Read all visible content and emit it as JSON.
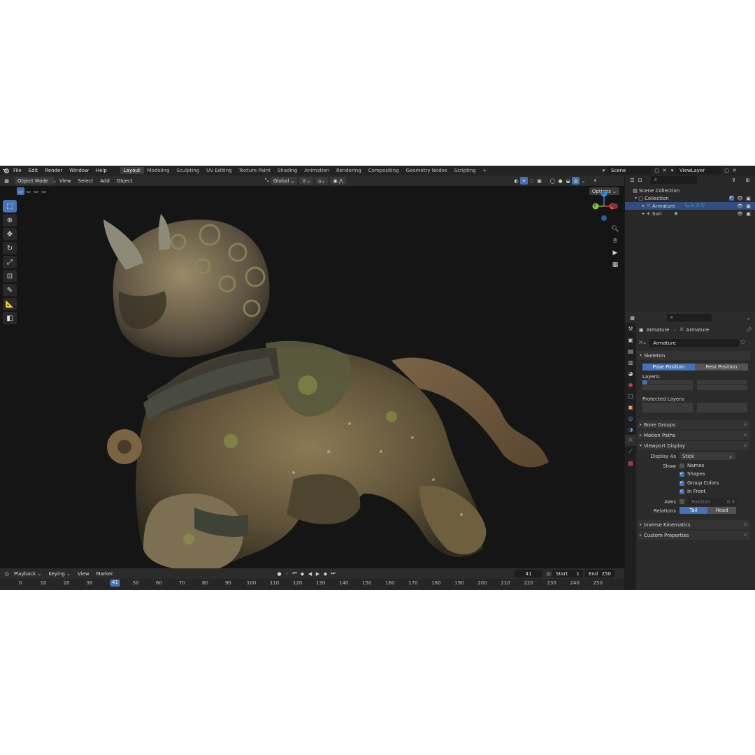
{
  "menubar": {
    "menus": [
      "File",
      "Edit",
      "Render",
      "Window",
      "Help"
    ],
    "workspaces": [
      "Layout",
      "Modeling",
      "Sculpting",
      "UV Editing",
      "Texture Paint",
      "Shading",
      "Animation",
      "Rendering",
      "Compositing",
      "Geometry Nodes",
      "Scripting"
    ],
    "active_workspace": "Layout",
    "add_tab": "+",
    "scene": "Scene",
    "view_layer": "ViewLayer"
  },
  "viewport_header": {
    "mode": "Object Mode",
    "menus": [
      "View",
      "Select",
      "Add",
      "Object"
    ],
    "orientation": "Global",
    "options": "Options"
  },
  "gizmo": {
    "z": "Z",
    "y": "Y",
    "x": "X"
  },
  "timeline": {
    "menus": [
      "Playback",
      "Keying",
      "View",
      "Marker"
    ],
    "current_frame": "41",
    "start_label": "Start",
    "start": "1",
    "end_label": "End",
    "end": "250",
    "ticks": [
      "0",
      "10",
      "20",
      "30",
      "40",
      "50",
      "60",
      "70",
      "80",
      "90",
      "100",
      "110",
      "120",
      "130",
      "140",
      "150",
      "160",
      "170",
      "180",
      "190",
      "200",
      "210",
      "220",
      "230",
      "240",
      "250"
    ]
  },
  "outliner": {
    "root": "Scene Collection",
    "collection": "Collection",
    "items": [
      "Armature",
      "Sun"
    ]
  },
  "properties": {
    "breadcrumb_object": "Armature",
    "breadcrumb_data": "Armature",
    "data_name": "Armature",
    "panels": {
      "skeleton": "Skeleton",
      "bone_groups": "Bone Groups",
      "motion_paths": "Motion Paths",
      "viewport_display": "Viewport Display",
      "inverse_kinematics": "Inverse Kinematics",
      "custom_properties": "Custom Properties"
    },
    "pose_position": "Pose Position",
    "rest_position": "Rest Position",
    "layers_label": "Layers:",
    "protected_layers_label": "Protected Layers:",
    "display_as_label": "Display As",
    "display_as_value": "Stick",
    "show_label": "Show",
    "show_names": "Names",
    "show_shapes": "Shapes",
    "show_group_colors": "Group Colors",
    "show_in_front": "In Front",
    "axes_label": "Axes",
    "axes_position": "Position",
    "axes_value": "0.0",
    "relations_label": "Relations",
    "relations_tail": "Tail",
    "relations_head": "Head"
  },
  "colors": {
    "accent": "#4772b3",
    "viewport_bg": "#151515",
    "gizmo_x": "#e0474f",
    "gizmo_y": "#8bc23c",
    "gizmo_z": "#3f8cdf"
  }
}
